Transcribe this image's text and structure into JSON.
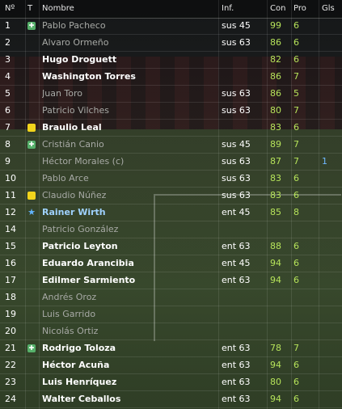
{
  "header": {
    "no": "Nº",
    "t": "T",
    "name": "Nombre",
    "inf": "Inf.",
    "con": "Con",
    "pro": "Pro",
    "gls": "Gls"
  },
  "players": [
    {
      "no": "1",
      "icon": "medical",
      "name": "Pablo Pacheco",
      "inf": "sus 45",
      "con": "99",
      "pro": "6",
      "gls": "",
      "active": false
    },
    {
      "no": "2",
      "icon": "",
      "name": "Alvaro Ormeño",
      "inf": "sus 63",
      "con": "86",
      "pro": "6",
      "gls": "",
      "active": false
    },
    {
      "no": "3",
      "icon": "",
      "name": "Hugo Droguett",
      "inf": "",
      "con": "82",
      "pro": "6",
      "gls": "",
      "active": true
    },
    {
      "no": "4",
      "icon": "",
      "name": "Washington Torres",
      "inf": "",
      "con": "86",
      "pro": "7",
      "gls": "",
      "active": true
    },
    {
      "no": "5",
      "icon": "",
      "name": "Juan Toro",
      "inf": "sus 63",
      "con": "86",
      "pro": "5",
      "gls": "",
      "active": false
    },
    {
      "no": "6",
      "icon": "",
      "name": "Patricio Vilches",
      "inf": "sus 63",
      "con": "80",
      "pro": "7",
      "gls": "",
      "active": false
    },
    {
      "no": "7",
      "icon": "card",
      "name": "Braulio Leal",
      "inf": "",
      "con": "83",
      "pro": "6",
      "gls": "",
      "active": true
    },
    {
      "no": "8",
      "icon": "medical",
      "name": "Cristián Canio",
      "inf": "sus 45",
      "con": "89",
      "pro": "7",
      "gls": "",
      "active": false
    },
    {
      "no": "9",
      "icon": "",
      "name": "Héctor Morales (c)",
      "inf": "sus 63",
      "con": "87",
      "pro": "7",
      "gls": "1",
      "active": false
    },
    {
      "no": "10",
      "icon": "",
      "name": "Pablo Arce",
      "inf": "sus 63",
      "con": "83",
      "pro": "6",
      "gls": "",
      "active": false
    },
    {
      "no": "11",
      "icon": "card",
      "name": "Claudio Núñez",
      "inf": "sus 63",
      "con": "83",
      "pro": "6",
      "gls": "",
      "active": false
    },
    {
      "no": "12",
      "icon": "star",
      "name": "Rainer Wirth",
      "inf": "ent 45",
      "con": "85",
      "pro": "8",
      "gls": "",
      "active": "star"
    },
    {
      "no": "14",
      "icon": "",
      "name": "Patricio González",
      "inf": "",
      "con": "",
      "pro": "",
      "gls": "",
      "active": false
    },
    {
      "no": "15",
      "icon": "",
      "name": "Patricio Leyton",
      "inf": "ent 63",
      "con": "88",
      "pro": "6",
      "gls": "",
      "active": true
    },
    {
      "no": "16",
      "icon": "",
      "name": "Eduardo Arancibia",
      "inf": "ent 45",
      "con": "94",
      "pro": "6",
      "gls": "",
      "active": true
    },
    {
      "no": "17",
      "icon": "",
      "name": "Edilmer Sarmiento",
      "inf": "ent 63",
      "con": "94",
      "pro": "6",
      "gls": "",
      "active": true
    },
    {
      "no": "18",
      "icon": "",
      "name": "Andrés Oroz",
      "inf": "",
      "con": "",
      "pro": "",
      "gls": "",
      "active": false
    },
    {
      "no": "19",
      "icon": "",
      "name": "Luis Garrido",
      "inf": "",
      "con": "",
      "pro": "",
      "gls": "",
      "active": false
    },
    {
      "no": "20",
      "icon": "",
      "name": "Nicolás Ortiz",
      "inf": "",
      "con": "",
      "pro": "",
      "gls": "",
      "active": false
    },
    {
      "no": "21",
      "icon": "medical",
      "name": "Rodrigo Toloza",
      "inf": "ent 63",
      "con": "78",
      "pro": "7",
      "gls": "",
      "active": true
    },
    {
      "no": "22",
      "icon": "",
      "name": "Héctor Acuña",
      "inf": "ent 63",
      "con": "94",
      "pro": "6",
      "gls": "",
      "active": true
    },
    {
      "no": "23",
      "icon": "",
      "name": "Luis Henríquez",
      "inf": "ent 63",
      "con": "80",
      "pro": "6",
      "gls": "",
      "active": true
    },
    {
      "no": "24",
      "icon": "",
      "name": "Walter Ceballos",
      "inf": "ent 63",
      "con": "94",
      "pro": "6",
      "gls": "",
      "active": true
    }
  ]
}
